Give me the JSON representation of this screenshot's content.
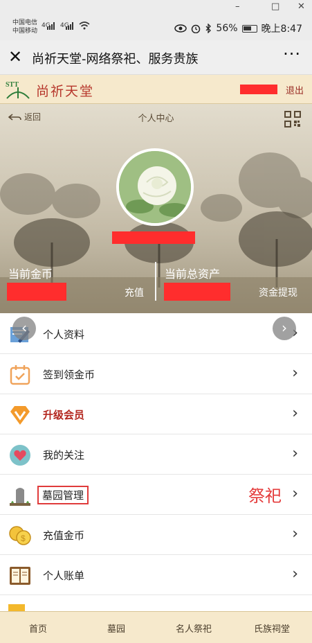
{
  "window": {
    "minimize": "–",
    "maximize": "□",
    "close": "✕"
  },
  "statusbar": {
    "carrier1": "中国电信",
    "carrier2": "中国移动",
    "net1": "4G",
    "net2": "4G",
    "battery": "56%",
    "time": "晚上8:47"
  },
  "titlebar": {
    "title": "尚祈天堂-网络祭祀、服务贵族",
    "more": "···"
  },
  "site": {
    "logo_text": "尚祈天堂",
    "logo_mark": "STT",
    "logout": "退出"
  },
  "hero": {
    "back_label": "返回",
    "title": "个人中心",
    "coins_label": "当前金币",
    "recharge": "充值",
    "assets_label": "当前总资产",
    "withdraw": "资金提现"
  },
  "menu": {
    "items": [
      {
        "label": "个人资料",
        "icon": "edit-profile-icon"
      },
      {
        "label": "签到领金币",
        "icon": "calendar-checkin-icon"
      },
      {
        "label": "升级会员",
        "icon": "vip-badge-icon"
      },
      {
        "label": "我的关注",
        "icon": "heart-icon"
      },
      {
        "label": "墓园管理",
        "icon": "tombstone-icon",
        "extra": "祭祀"
      },
      {
        "label": "充值金币",
        "icon": "coins-icon"
      },
      {
        "label": "个人账单",
        "icon": "ledger-book-icon"
      }
    ]
  },
  "nav_arrows": {
    "left": "‹",
    "right": "›"
  },
  "bottomnav": {
    "tabs": [
      "首页",
      "墓园",
      "名人祭祀",
      "氏族祠堂"
    ]
  },
  "colors": {
    "accent_red": "#e43a3a",
    "header_bg": "#f6e9cc",
    "vip_red": "#b3261e"
  }
}
